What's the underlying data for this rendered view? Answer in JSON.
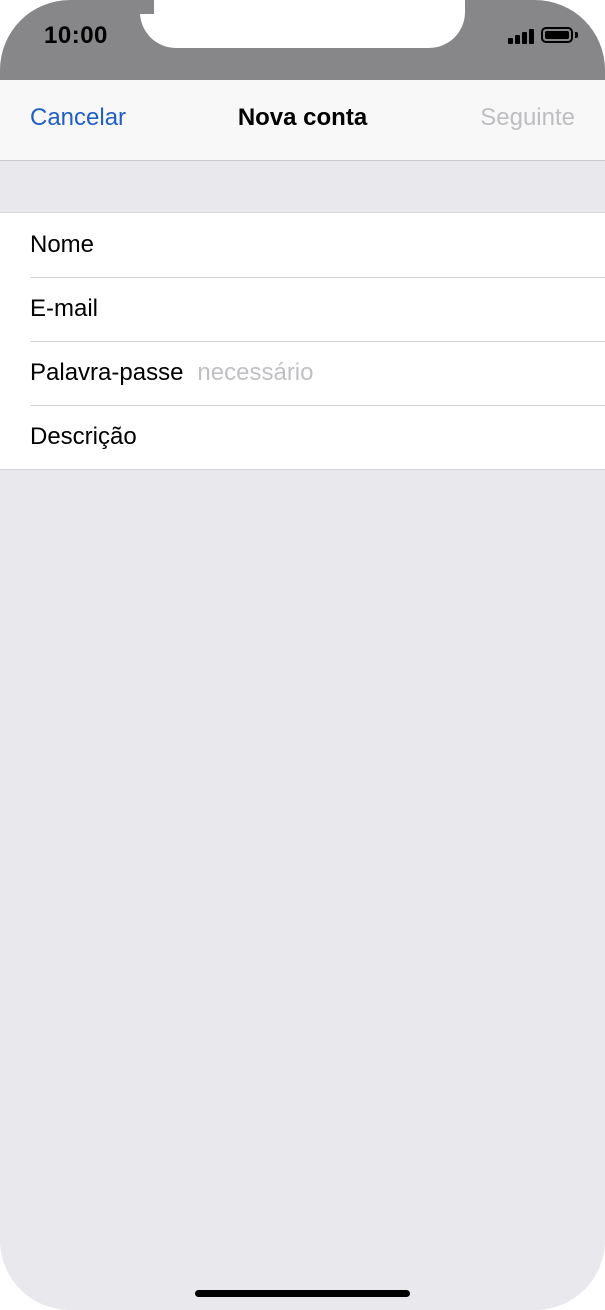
{
  "status_bar": {
    "time": "10:00",
    "signal_icon": "cellular-signal-icon",
    "battery_icon": "battery-icon",
    "battery_level": 1.0
  },
  "nav": {
    "cancel_label": "Cancelar",
    "title": "Nova conta",
    "next_label": "Seguinte"
  },
  "form": {
    "fields": [
      {
        "label": "Nome",
        "value": "",
        "placeholder": ""
      },
      {
        "label": "E-mail",
        "value": "",
        "placeholder": ""
      },
      {
        "label": "Palavra-passe",
        "value": "",
        "placeholder": "necessário"
      },
      {
        "label": "Descrição",
        "value": "",
        "placeholder": ""
      }
    ]
  },
  "colors": {
    "accent": "#1f5fc6",
    "disabled": "#bdbdc2",
    "background": "#e9e8ed",
    "status_bar": "#878789"
  }
}
